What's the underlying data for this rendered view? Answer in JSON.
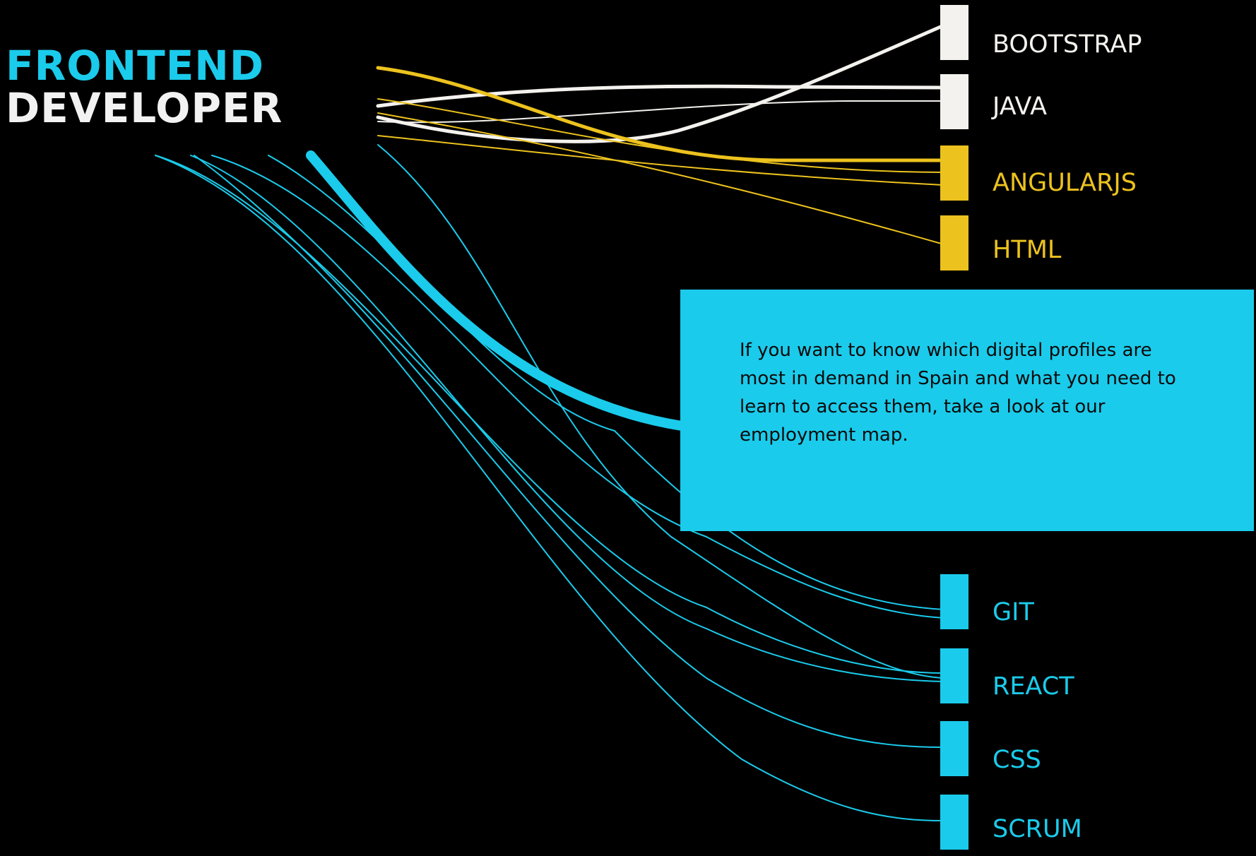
{
  "title": {
    "line1": "FRONTEND",
    "line2": "DEVELOPER",
    "line1_color": "#1bcbeb",
    "line2_color": "#f2f2f2"
  },
  "callout": {
    "text": "If you want to know which digital profiles are most in demand in Spain and what you need to learn to access them, take a look at our employment map.",
    "background": "#1bcbeb"
  },
  "colors": {
    "background": "#000000",
    "white": "#f4f2ee",
    "yellow": "#ecc21e",
    "cyan": "#1bcbeb"
  },
  "skills": [
    {
      "id": "bootstrap",
      "label": "BOOTSTRAP",
      "color": "#f4f2ee"
    },
    {
      "id": "java",
      "label": "JAVA",
      "color": "#f4f2ee"
    },
    {
      "id": "angularjs",
      "label": "ANGULARJS",
      "color": "#ecc21e"
    },
    {
      "id": "html",
      "label": "HTML",
      "color": "#ecc21e"
    },
    {
      "id": "git",
      "label": "GIT",
      "color": "#1bcbeb"
    },
    {
      "id": "react",
      "label": "REACT",
      "color": "#1bcbeb"
    },
    {
      "id": "css",
      "label": "CSS",
      "color": "#1bcbeb"
    },
    {
      "id": "scrum",
      "label": "SCRUM",
      "color": "#1bcbeb"
    }
  ],
  "flows": [
    {
      "to": "bootstrap",
      "color": "#f4f2ee",
      "weight": "medium"
    },
    {
      "to": "java",
      "color": "#f4f2ee",
      "weight": "medium"
    },
    {
      "to": "java",
      "color": "#f4f2ee",
      "weight": "thin"
    },
    {
      "to": "angularjs",
      "color": "#ecc21e",
      "weight": "medium"
    },
    {
      "to": "angularjs",
      "color": "#ecc21e",
      "weight": "thin"
    },
    {
      "to": "angularjs",
      "color": "#ecc21e",
      "weight": "thin"
    },
    {
      "to": "html",
      "color": "#ecc21e",
      "weight": "thin"
    },
    {
      "to": "git",
      "color": "#1bcbeb",
      "weight": "thick"
    },
    {
      "to": "git",
      "color": "#1bcbeb",
      "weight": "thin"
    },
    {
      "to": "git",
      "color": "#1bcbeb",
      "weight": "thin"
    },
    {
      "to": "react",
      "color": "#1bcbeb",
      "weight": "thin"
    },
    {
      "to": "react",
      "color": "#1bcbeb",
      "weight": "thin"
    },
    {
      "to": "react",
      "color": "#1bcbeb",
      "weight": "thin"
    },
    {
      "to": "css",
      "color": "#1bcbeb",
      "weight": "thin"
    },
    {
      "to": "scrum",
      "color": "#1bcbeb",
      "weight": "thin"
    }
  ]
}
